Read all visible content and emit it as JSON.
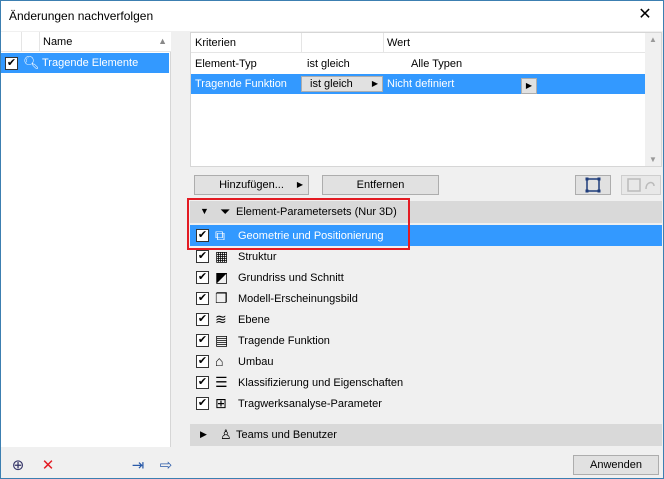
{
  "window": {
    "title": "Änderungen nachverfolgen",
    "close_glyph": "✕"
  },
  "left_panel": {
    "column_header": "Name",
    "items": [
      {
        "label": "Tragende Elemente",
        "checked": true,
        "icon": "magnifier-icon"
      }
    ]
  },
  "criteria": {
    "headers": {
      "kriterien": "Kriterien",
      "wert": "Wert"
    },
    "rows": [
      {
        "kriterium": "Element-Typ",
        "operator": "ist gleich",
        "wert": "Alle Typen",
        "selected": false
      },
      {
        "kriterium": "Tragende Funktion",
        "operator": "ist gleich",
        "wert": "Nicht definiert",
        "selected": true
      }
    ]
  },
  "buttons": {
    "add": "Hinzufügen...",
    "remove": "Entfernen",
    "apply": "Anwenden"
  },
  "sections": {
    "element_parametersets": "Element-Parametersets (Nur 3D)",
    "teams": "Teams und Benutzer"
  },
  "parameter_items": [
    {
      "label": "Geometrie und Positionierung",
      "checked": true,
      "selected": true,
      "icon": "geometry-icon"
    },
    {
      "label": "Struktur",
      "checked": true,
      "selected": false,
      "icon": "structure-icon"
    },
    {
      "label": "Grundriss und Schnitt",
      "checked": true,
      "selected": false,
      "icon": "floorplan-icon"
    },
    {
      "label": "Modell-Erscheinungsbild",
      "checked": true,
      "selected": false,
      "icon": "appearance-icon"
    },
    {
      "label": "Ebene",
      "checked": true,
      "selected": false,
      "icon": "layer-icon"
    },
    {
      "label": "Tragende Funktion",
      "checked": true,
      "selected": false,
      "icon": "structural-function-icon"
    },
    {
      "label": "Umbau",
      "checked": true,
      "selected": false,
      "icon": "renovation-icon"
    },
    {
      "label": "Klassifizierung und Eigenschaften",
      "checked": true,
      "selected": false,
      "icon": "classification-icon"
    },
    {
      "label": "Tragwerksanalyse-Parameter",
      "checked": true,
      "selected": false,
      "icon": "analysis-icon"
    }
  ],
  "colors": {
    "selection": "#3399ff",
    "highlight_border": "#e31b23",
    "section_bg": "#d9d9d9"
  }
}
